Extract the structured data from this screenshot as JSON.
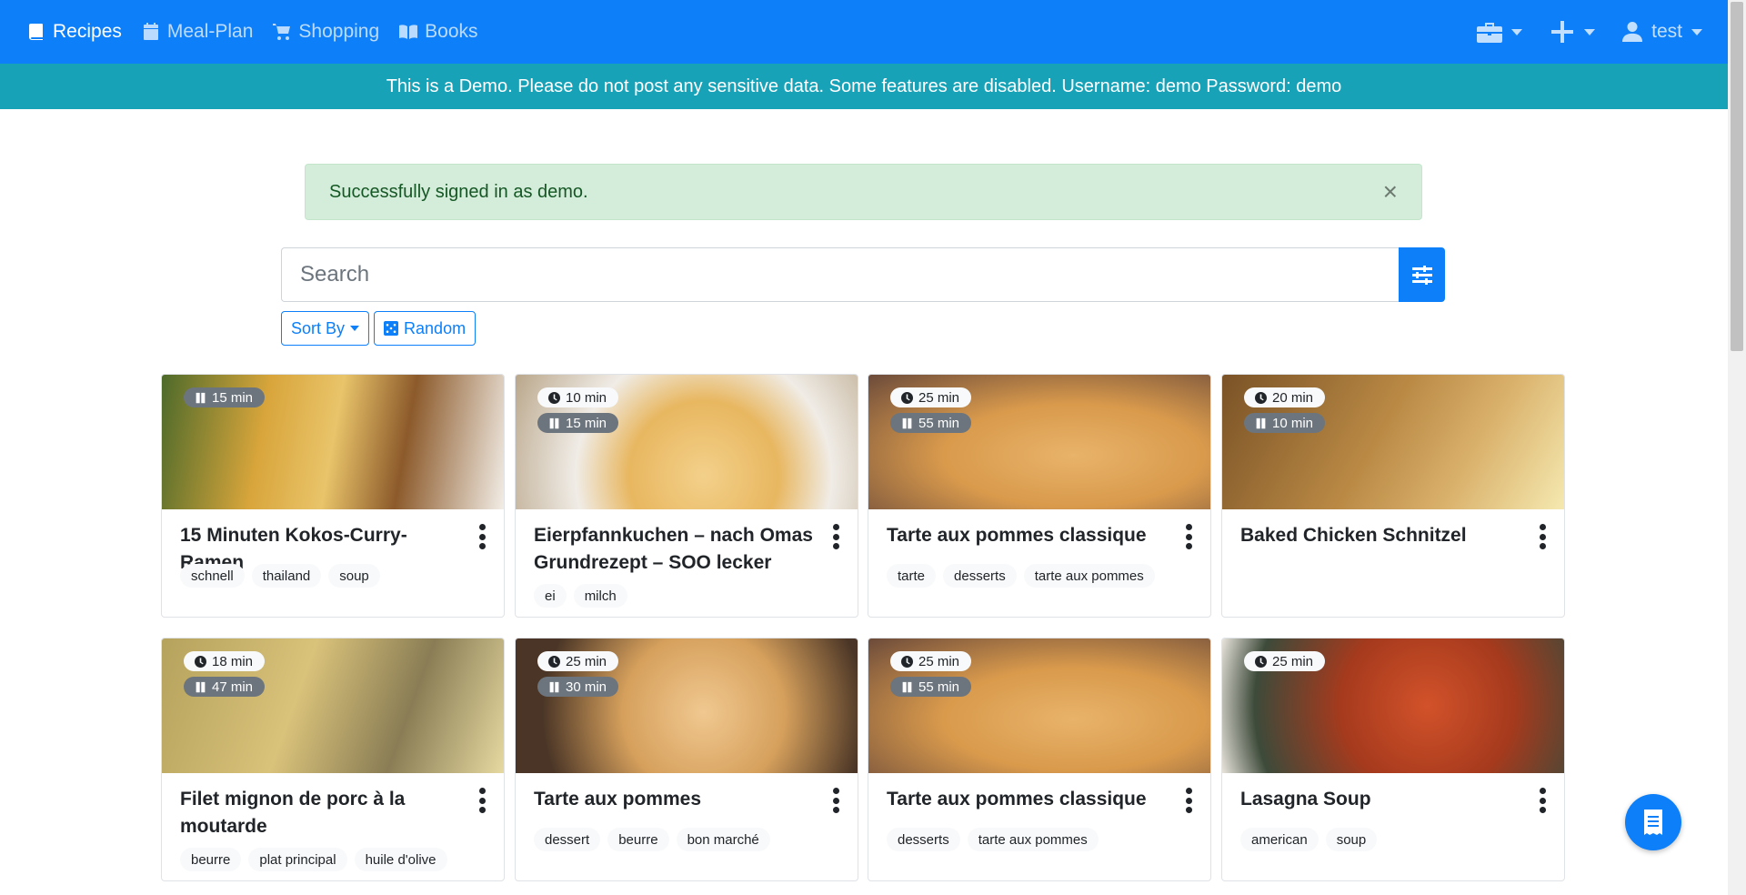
{
  "nav": {
    "items": [
      {
        "label": "Recipes",
        "icon": "book-icon",
        "active": true
      },
      {
        "label": "Meal-Plan",
        "icon": "calendar-icon",
        "active": false
      },
      {
        "label": "Shopping",
        "icon": "cart-icon",
        "active": false
      },
      {
        "label": "Books",
        "icon": "open-book-icon",
        "active": false
      }
    ],
    "user_label": "test",
    "toolbox_icon": "toolbox-icon",
    "add_icon": "plus-icon",
    "user_icon": "user-icon"
  },
  "banner": {
    "text": "This is a Demo. Please do not post any sensitive data. Some features are disabled. Username: demo Password: demo"
  },
  "alert": {
    "text": "Successfully signed in as demo.",
    "close_label": "×"
  },
  "search": {
    "placeholder": "Search",
    "value": ""
  },
  "buttons": {
    "sort_label": "Sort By",
    "random_label": "Random"
  },
  "recipes": [
    {
      "title": "15 Minuten Kokos-Curry-Ramen",
      "working_time": "",
      "waiting_time": "15 min",
      "tags": [
        "schnell",
        "thailand",
        "soup"
      ]
    },
    {
      "title": "Eierpfannkuchen – nach Omas Grundrezept – SOO lecker",
      "working_time": "10 min",
      "waiting_time": "15 min",
      "tags": [
        "ei",
        "milch"
      ]
    },
    {
      "title": "Tarte aux pommes classique",
      "working_time": "25 min",
      "waiting_time": "55 min",
      "tags": [
        "tarte",
        "desserts",
        "tarte aux pommes"
      ]
    },
    {
      "title": "Baked Chicken Schnitzel",
      "working_time": "20 min",
      "waiting_time": "10 min",
      "tags": []
    },
    {
      "title": "Filet mignon de porc à la moutarde",
      "working_time": "18 min",
      "waiting_time": "47 min",
      "tags": [
        "beurre",
        "plat principal",
        "huile d'olive"
      ]
    },
    {
      "title": "Tarte aux pommes",
      "working_time": "25 min",
      "waiting_time": "30 min",
      "tags": [
        "dessert",
        "beurre",
        "bon marché"
      ]
    },
    {
      "title": "Tarte aux pommes classique",
      "working_time": "25 min",
      "waiting_time": "55 min",
      "tags": [
        "desserts",
        "tarte aux pommes"
      ]
    },
    {
      "title": "Lasagna Soup",
      "working_time": "25 min",
      "waiting_time": "",
      "tags": [
        "american",
        "soup"
      ]
    }
  ],
  "colors": {
    "primary": "#0d7ff9",
    "banner": "#17a2b8",
    "alert_bg": "#d4edda",
    "alert_text": "#155724"
  },
  "fab_icon": "receipt-icon"
}
